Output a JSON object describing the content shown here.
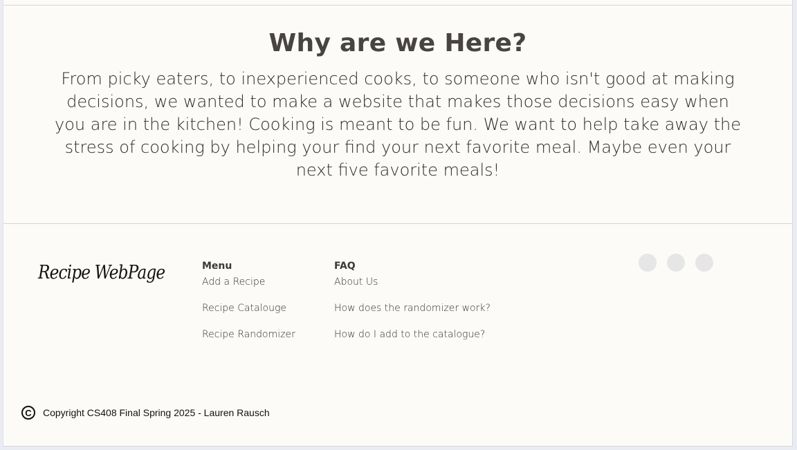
{
  "about": {
    "title": "Why are we Here?",
    "body": "From picky eaters, to inexperienced cooks, to someone who isn't good at making decisions, we wanted to make a website that makes those decisions easy when you are in the kitchen! Cooking is meant to be fun. We want to help take away the stress of cooking by helping your find your next favorite meal. Maybe even your next five favorite meals!"
  },
  "footer": {
    "brand": "Recipe WebPage",
    "menu": {
      "heading": "Menu",
      "items": [
        "Add a Recipe",
        "Recipe Catalouge",
        "Recipe Randomizer"
      ]
    },
    "faq": {
      "heading": "FAQ",
      "items": [
        "About Us",
        "How does the randomizer work?",
        "How do I add to the catalogue?"
      ]
    },
    "social_icons": [
      "social-icon-1",
      "social-icon-2",
      "social-icon-3"
    ],
    "copyright_symbol": "C",
    "copyright": "Copyright CS408 Final Spring 2025 - Lauren Rausch"
  },
  "colors": {
    "page_background": "#fcfbf7",
    "outer_background": "#e9ecf2",
    "heading_text": "#474442",
    "social_placeholder": "#e6e6e7"
  }
}
